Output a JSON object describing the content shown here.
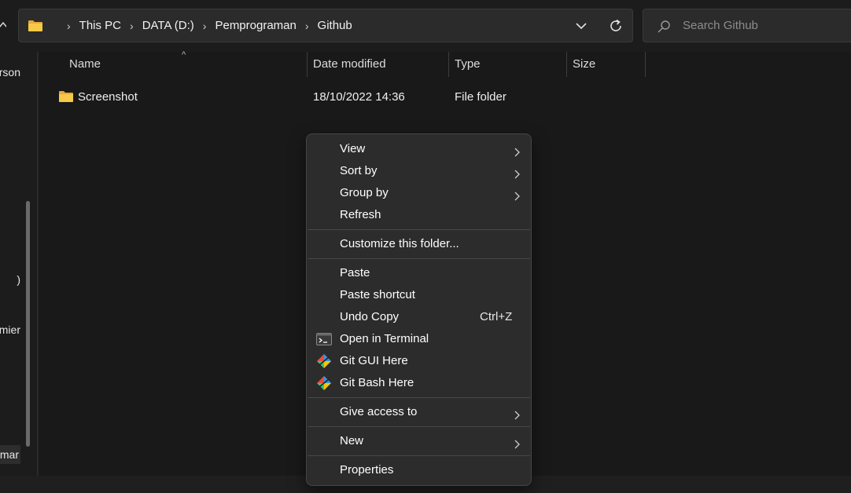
{
  "address": {
    "crumbs": [
      "This PC",
      "DATA (D:)",
      "Pemprograman",
      "Github"
    ],
    "separator": "›"
  },
  "search": {
    "placeholder": "Search Github"
  },
  "nav": {
    "items": [
      "rson",
      ")",
      "mier",
      "mar"
    ]
  },
  "columns": {
    "name": "Name",
    "date": "Date modified",
    "type": "Type",
    "size": "Size"
  },
  "files": [
    {
      "name": "Screenshot",
      "date": "18/10/2022 14:36",
      "type": "File folder",
      "size": ""
    }
  ],
  "menu": {
    "view": "View",
    "sort_by": "Sort by",
    "group_by": "Group by",
    "refresh": "Refresh",
    "customize": "Customize this folder...",
    "paste": "Paste",
    "paste_shortcut": "Paste shortcut",
    "undo_copy": "Undo Copy",
    "undo_shortcut": "Ctrl+Z",
    "open_terminal": "Open in Terminal",
    "git_gui": "Git GUI Here",
    "git_bash": "Git Bash Here",
    "give_access": "Give access to",
    "new": "New",
    "properties": "Properties"
  },
  "colors": {
    "folder": "#f5c24c",
    "background": "#191919",
    "menu_background": "#2c2c2c"
  }
}
